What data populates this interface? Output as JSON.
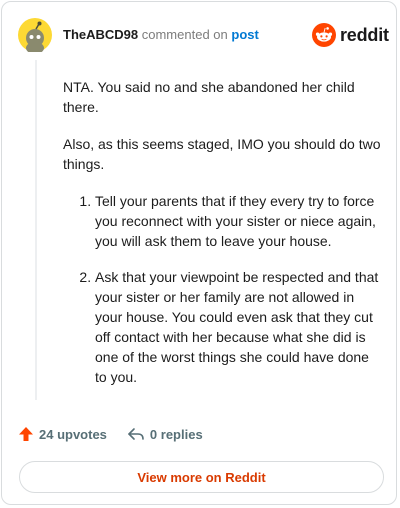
{
  "header": {
    "username": "TheABCD98",
    "commented_on": "commented on",
    "post_link": "post",
    "logo_text": "reddit"
  },
  "comment": {
    "paragraphs": [
      "NTA. You said no and she abandoned her child there.",
      "Also, as this seems staged, IMO you should do two things."
    ],
    "list_items": [
      "Tell your parents that if they every try to force you reconnect with your sister or niece again, you will ask them to leave your house.",
      "Ask that your viewpoint be respected and that your sister or her family are not allowed in your house. You could even ask that they cut off contact with her because what she did is one of the worst things she could have done to you."
    ]
  },
  "actions": {
    "upvotes": "24 upvotes",
    "replies": "0 replies"
  },
  "footer": {
    "view_more": "View more on Reddit"
  },
  "colors": {
    "accent": "#ff4500",
    "link": "#0079d3",
    "view_more_text": "#d93a00"
  },
  "icons": {
    "avatar": "snoo-avatar-icon",
    "logo": "reddit-logo-icon",
    "upvote": "upvote-arrow-icon",
    "reply": "reply-arrow-icon"
  }
}
